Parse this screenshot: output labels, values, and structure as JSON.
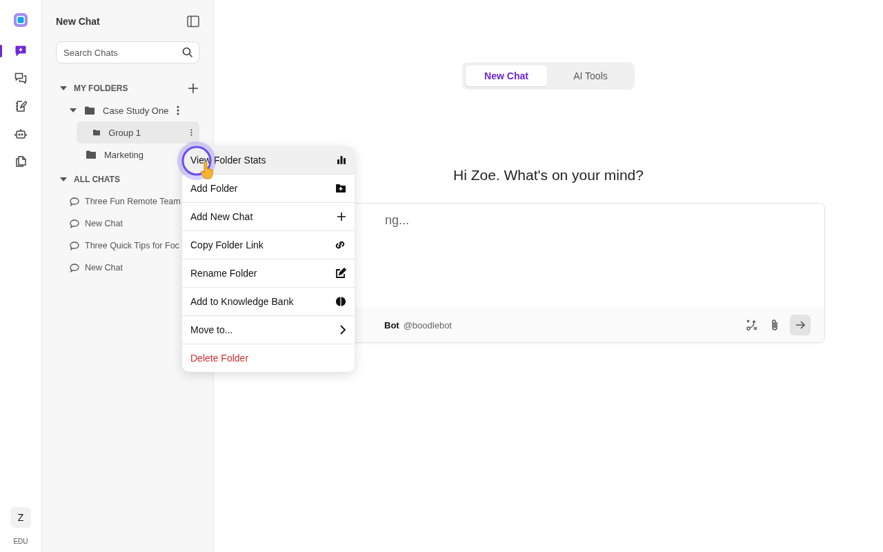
{
  "rail": {
    "items": [
      {
        "kind": "new-chat",
        "selected": true
      },
      {
        "kind": "chats",
        "selected": false
      },
      {
        "kind": "notes",
        "selected": false
      },
      {
        "kind": "bot",
        "selected": false
      },
      {
        "kind": "files",
        "selected": false
      }
    ],
    "avatar": "Z",
    "plan": "EDU"
  },
  "sidebar": {
    "title": "New Chat",
    "search": {
      "placeholder": "Search Chats"
    },
    "folders": {
      "label": "MY FOLDERS",
      "expanded": true,
      "items": [
        {
          "name": "Case Study One",
          "expanded": true,
          "selected": false,
          "children": [
            {
              "name": "Group 1",
              "selected": true
            }
          ]
        },
        {
          "name": "Marketing",
          "selected": false
        }
      ]
    },
    "chats": {
      "label": "ALL CHATS",
      "expanded": true,
      "items": [
        {
          "title": "Three Fun Remote Team"
        },
        {
          "title": "New Chat"
        },
        {
          "title": "Three Quick Tips for Foc"
        },
        {
          "title": "New Chat"
        }
      ]
    }
  },
  "main": {
    "tabs": [
      {
        "label": "New Chat",
        "selected": true
      },
      {
        "label": "AI Tools",
        "selected": false
      }
    ],
    "greeting": "Hi Zoe. What's on your mind?",
    "composer": {
      "text": "ng...",
      "bot_name": "Bot",
      "bot_handle": "@boodlebot"
    }
  },
  "context_menu": {
    "items": [
      {
        "label": "View Folder Stats",
        "kind": "stats",
        "selected": true,
        "danger": false
      },
      {
        "label": "Add Folder",
        "kind": "add-folder",
        "selected": false,
        "danger": false
      },
      {
        "label": "Add New Chat",
        "kind": "plus",
        "selected": false,
        "danger": false
      },
      {
        "label": "Copy Folder Link",
        "kind": "link",
        "selected": false,
        "danger": false
      },
      {
        "label": "Rename Folder",
        "kind": "edit",
        "selected": false,
        "danger": false
      },
      {
        "label": "Add to Knowledge Bank",
        "kind": "brain",
        "selected": false,
        "danger": false
      },
      {
        "label": "Move to...",
        "kind": "chevron",
        "selected": false,
        "danger": false
      },
      {
        "label": "Delete Folder",
        "kind": "none",
        "selected": false,
        "danger": true
      }
    ]
  }
}
